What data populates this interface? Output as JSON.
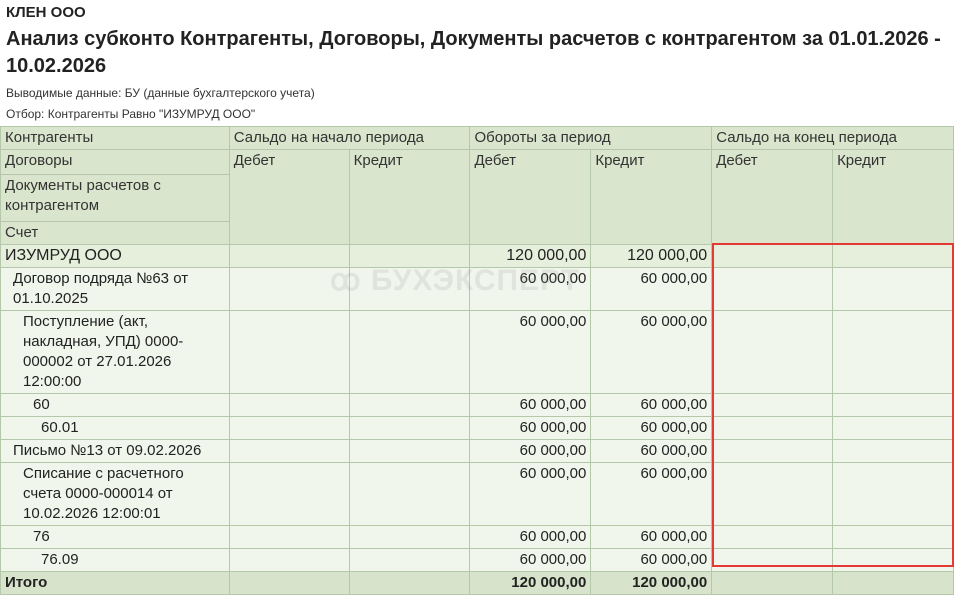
{
  "header": {
    "org": "КЛЕН ООО",
    "title": "Анализ субконто Контрагенты, Договоры, Документы расчетов с контрагентом за 01.01.2026 - 10.02.2026",
    "output": "Выводимые данные: БУ (данные бухгалтерского учета)",
    "filter": "Отбор: Контрагенты Равно \"ИЗУМРУД ООО\""
  },
  "watermark": "ꝏ БУХЭКСПЕРТ",
  "columns": {
    "counterparties": "Контрагенты",
    "contracts": "Договоры",
    "documents": "Документы расчетов с контрагентом",
    "account": "Счет",
    "opening": "Сальдо на начало периода",
    "turnover": "Обороты за период",
    "closing": "Сальдо на конец периода",
    "debit": "Дебет",
    "credit": "Кредит"
  },
  "rows": [
    {
      "label": "ИЗУМРУД ООО",
      "td": "120 000,00",
      "tc": "120 000,00"
    },
    {
      "label": "Договор подряда №63 от 01.10.2025",
      "td": "60 000,00",
      "tc": "60 000,00"
    },
    {
      "label": "Поступление (акт, накладная, УПД) 0000-000002 от 27.01.2026 12:00:00",
      "td": "60 000,00",
      "tc": "60 000,00"
    },
    {
      "label": "60",
      "td": "60 000,00",
      "tc": "60 000,00"
    },
    {
      "label": "60.01",
      "td": "60 000,00",
      "tc": "60 000,00"
    },
    {
      "label": "Письмо №13 от 09.02.2026",
      "td": "60 000,00",
      "tc": "60 000,00"
    },
    {
      "label": "Списание с расчетного счета 0000-000014 от 10.02.2026 12:00:01",
      "td": "60 000,00",
      "tc": "60 000,00"
    },
    {
      "label": "76",
      "td": "60 000,00",
      "tc": "60 000,00"
    },
    {
      "label": "76.09",
      "td": "60 000,00",
      "tc": "60 000,00"
    }
  ],
  "total": {
    "label": "Итого",
    "td": "120 000,00",
    "tc": "120 000,00"
  }
}
